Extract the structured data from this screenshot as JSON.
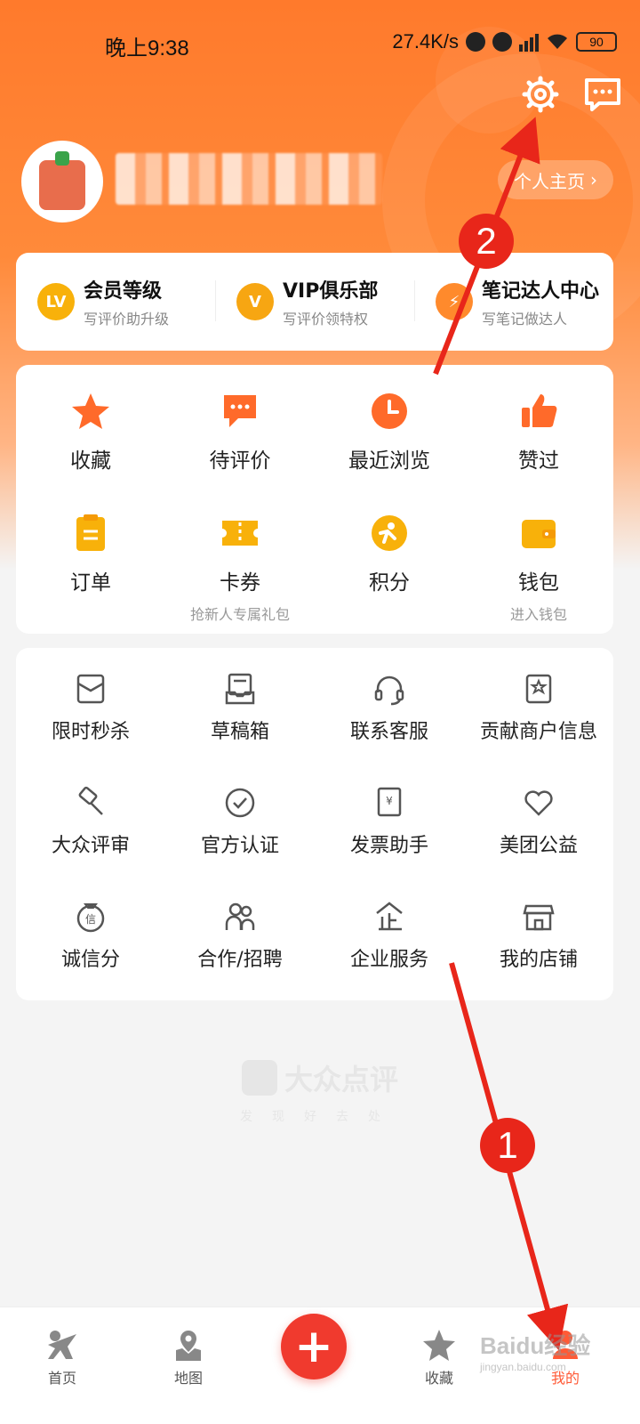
{
  "status_bar": {
    "time": "晚上9:38",
    "network_speed": "27.4K/s",
    "battery": "90"
  },
  "header": {
    "homepage_label": "个人主页"
  },
  "levels": [
    {
      "title": "会员等级",
      "subtitle": "写评价助升级",
      "badge": "LV"
    },
    {
      "title": "VIP俱乐部",
      "subtitle": "写评价领特权",
      "badge": "V"
    },
    {
      "title": "笔记达人中心",
      "subtitle": "写笔记做达人",
      "badge": "⚡"
    }
  ],
  "quick_items": [
    {
      "label": "收藏",
      "sub": "",
      "icon": "star-icon"
    },
    {
      "label": "待评价",
      "sub": "",
      "icon": "comment-icon"
    },
    {
      "label": "最近浏览",
      "sub": "",
      "icon": "clock-icon"
    },
    {
      "label": "赞过",
      "sub": "",
      "icon": "thumbs-up-icon"
    },
    {
      "label": "订单",
      "sub": "",
      "icon": "order-icon"
    },
    {
      "label": "卡券",
      "sub": "抢新人专属礼包",
      "icon": "ticket-icon"
    },
    {
      "label": "积分",
      "sub": "",
      "icon": "points-icon"
    },
    {
      "label": "钱包",
      "sub": "进入钱包",
      "icon": "wallet-icon"
    }
  ],
  "more_items": [
    {
      "label": "限时秒杀",
      "icon": "flash-sale-icon"
    },
    {
      "label": "草稿箱",
      "icon": "drafts-icon"
    },
    {
      "label": "联系客服",
      "icon": "headset-icon"
    },
    {
      "label": "贡献商户信息",
      "icon": "merchant-info-icon"
    },
    {
      "label": "大众评审",
      "icon": "gavel-icon"
    },
    {
      "label": "官方认证",
      "icon": "check-circle-icon"
    },
    {
      "label": "发票助手",
      "icon": "invoice-icon"
    },
    {
      "label": "美团公益",
      "icon": "charity-heart-icon"
    },
    {
      "label": "诚信分",
      "icon": "credit-score-icon"
    },
    {
      "label": "合作/招聘",
      "icon": "people-icon"
    },
    {
      "label": "企业服务",
      "icon": "enterprise-icon"
    },
    {
      "label": "我的店铺",
      "icon": "shop-icon"
    }
  ],
  "brand": {
    "name": "大众点评",
    "slogan": "发现好去处"
  },
  "tabbar": [
    {
      "label": "首页",
      "icon": "home-icon"
    },
    {
      "label": "地图",
      "icon": "map-icon"
    },
    {
      "label": "收藏",
      "icon": "star-icon"
    },
    {
      "label": "我的",
      "icon": "profile-icon"
    }
  ],
  "annotations": {
    "badge_1": "1",
    "badge_2": "2"
  },
  "watermark": {
    "text": "Baidu经验",
    "url": "jingyan.baidu.com"
  },
  "colors": {
    "accent": "#ff7a2c",
    "annotation_red": "#e8261a",
    "icon_orange": "#ff6a2a",
    "icon_yellow": "#f8b10a"
  }
}
